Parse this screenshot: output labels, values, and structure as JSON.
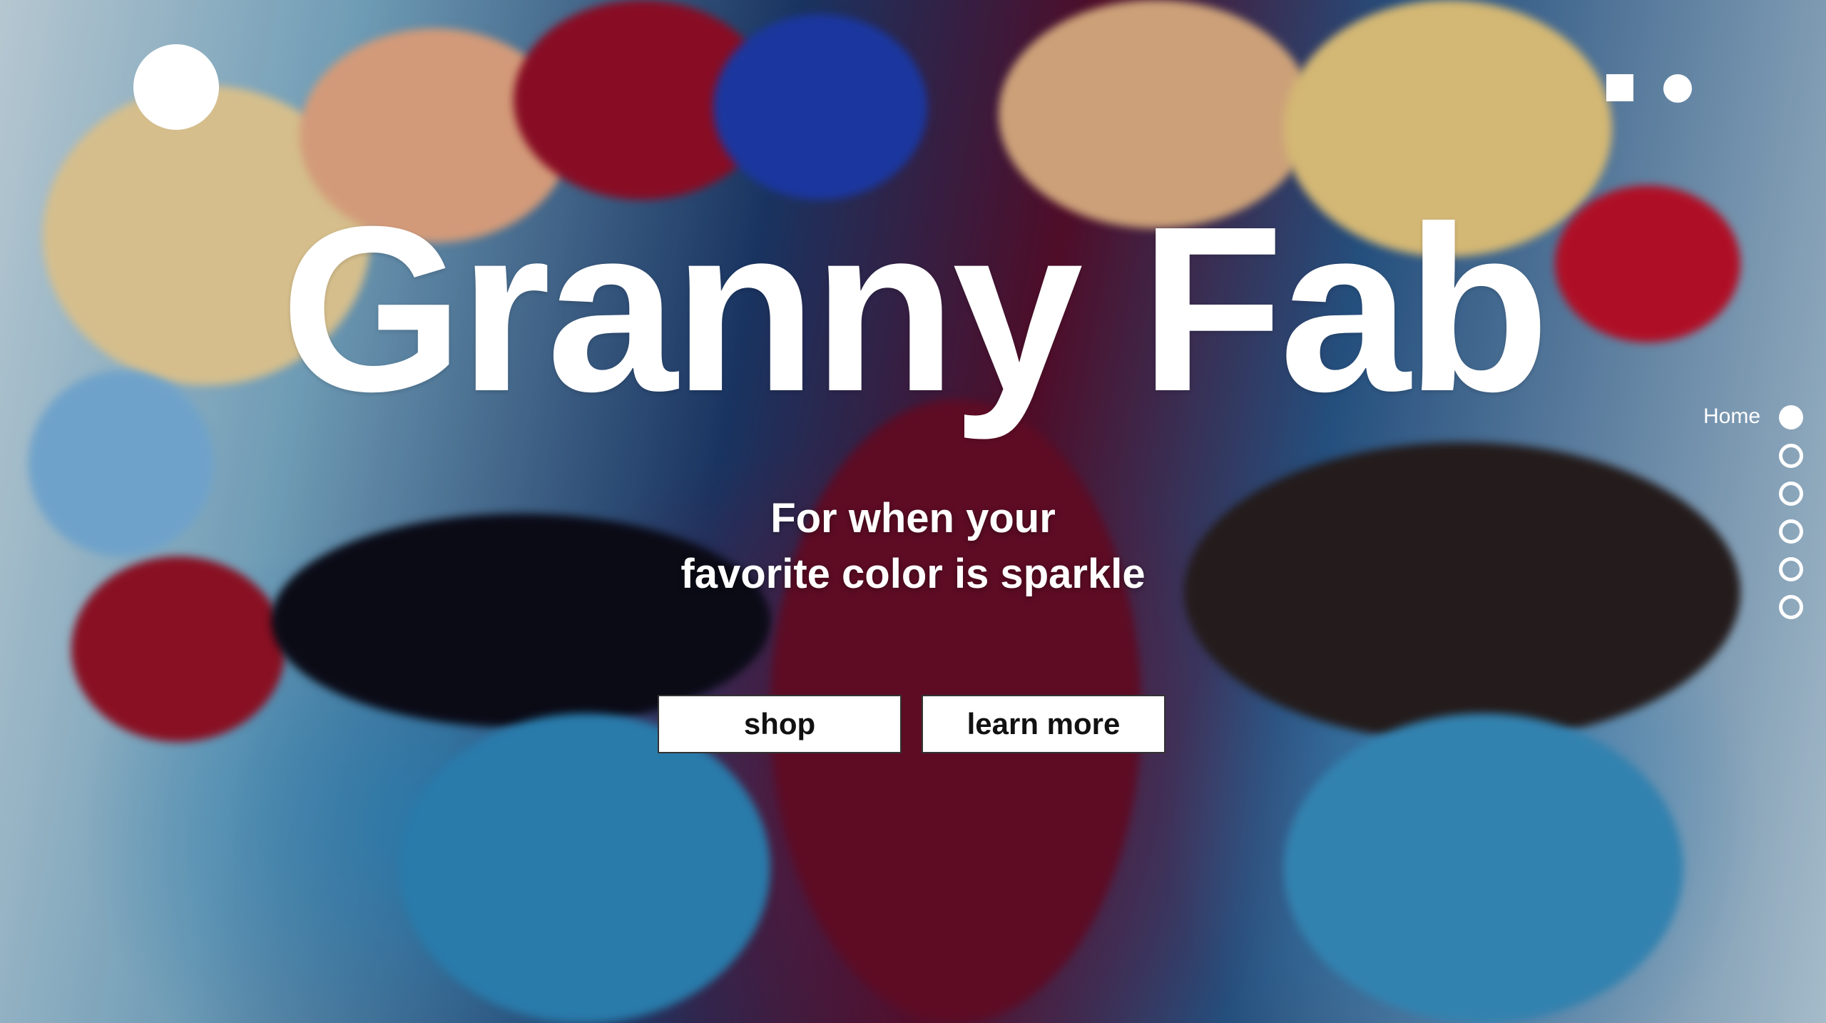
{
  "header": {
    "logo_icon": "circle-logo-icon",
    "menu_icon": "menu-icon"
  },
  "hero": {
    "title": "Granny Fab",
    "subtitle_line1": "For when your",
    "subtitle_line2": "favorite color is sparkle",
    "shop_label": "shop",
    "learn_more_label": "learn more"
  },
  "side_nav": {
    "home_label": "Home",
    "dots": [
      "active",
      "idle",
      "idle",
      "idle",
      "idle",
      "idle"
    ]
  },
  "colors": {
    "text": "#ffffff",
    "button_bg": "#ffffff",
    "button_text": "#111111"
  }
}
